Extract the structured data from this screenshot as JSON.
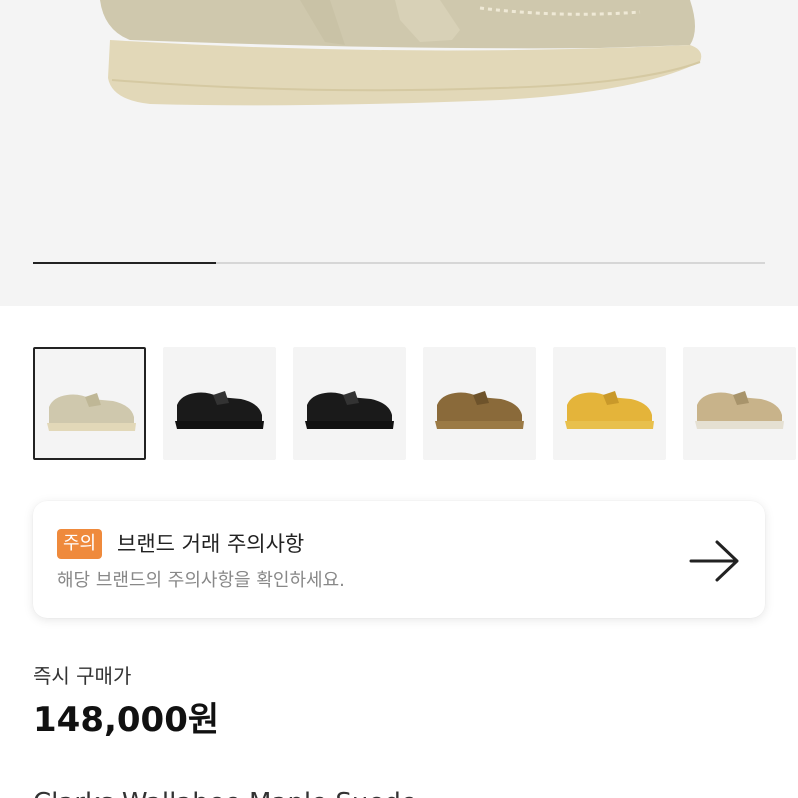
{
  "hero": {
    "image": "suede-wallabee-shoe-maple",
    "carousel_progress": 0.25
  },
  "thumbnails": [
    {
      "color": "maple",
      "selected": true
    },
    {
      "color": "black"
    },
    {
      "color": "black"
    },
    {
      "color": "brown"
    },
    {
      "color": "yellow"
    },
    {
      "color": "beige"
    }
  ],
  "notice": {
    "badge": "주의",
    "title": "브랜드 거래 주의사항",
    "subtitle": "해당 브랜드의 주의사항을 확인하세요.",
    "arrow_icon": "arrow-right-icon",
    "badge_color": "#ef8a3c"
  },
  "price": {
    "label": "즉시 구매가",
    "value": "148,000원"
  },
  "product": {
    "name": "Clarks Wallabee Maple Suede"
  }
}
